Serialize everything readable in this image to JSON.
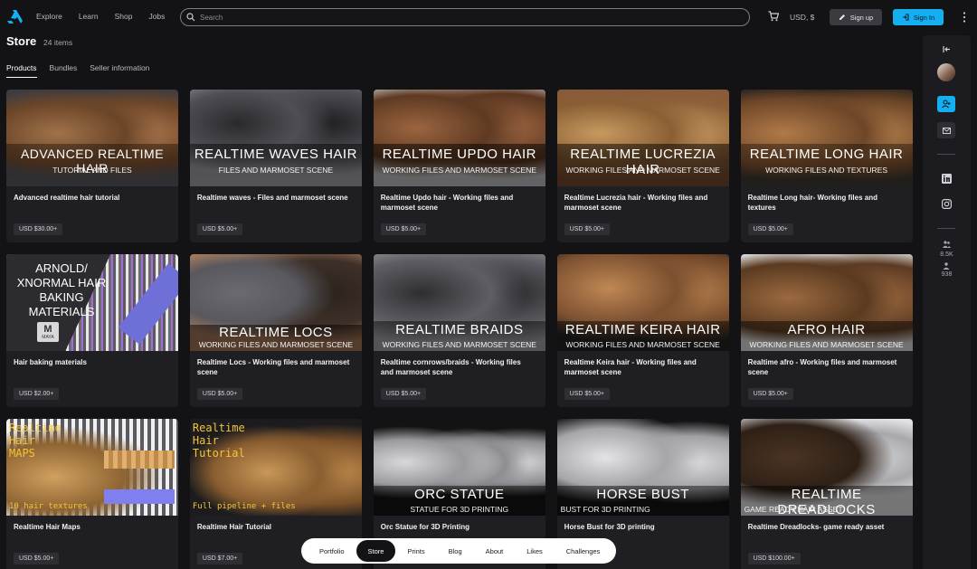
{
  "nav": {
    "links": [
      "Explore",
      "Learn",
      "Shop",
      "Jobs"
    ],
    "search_placeholder": "Search",
    "currency": "USD, $",
    "signup": "Sign up",
    "signin": "Sign In"
  },
  "header": {
    "title": "Store",
    "count": "24 items",
    "tabs": [
      "Products",
      "Bundles",
      "Seller information"
    ]
  },
  "products": [
    {
      "title": "Advanced realtime hair tutorial",
      "price": "USD $30.00+",
      "thumb_l1": "ADVANCED REALTIME HAIR",
      "thumb_l2": "TUTORIAL AND FILES"
    },
    {
      "title": "Realtime waves - Files and marmoset scene",
      "price": "USD $5.00+",
      "thumb_l1": "REALTIME WAVES HAIR",
      "thumb_l2": "FILES AND MARMOSET SCENE"
    },
    {
      "title": "Realtime Updo hair - Working files and marmoset scene",
      "price": "USD $5.00+",
      "thumb_l1": "REALTIME UPDO HAIR",
      "thumb_l2": "WORKING FILES AND MARMOSET SCENE"
    },
    {
      "title": "Realtime Lucrezia hair - Working files and marmoset scene",
      "price": "USD $5.00+",
      "thumb_l1": "REALTIME LUCREZIA HAIR",
      "thumb_l2": "WORKING FILES AND MARMOSET SCENE"
    },
    {
      "title": "Realtime Long hair- Working files and textures",
      "price": "USD $5.00+",
      "thumb_l1": "REALTIME LONG HAIR",
      "thumb_l2": "WORKING FILES AND TEXTURES"
    },
    {
      "title": "Hair baking materials",
      "price": "USD $2.00+",
      "thumb_l1": "ARNOLD/ XNORMAL HAIR BAKING MATERIALS",
      "thumb_l2": "MAYA"
    },
    {
      "title": "Realtime Locs - Working files and marmoset scene",
      "price": "USD $5.00+",
      "thumb_l1": "REALTIME LOCS",
      "thumb_l2": "WORKING FILES AND MARMOSET SCENE"
    },
    {
      "title": "Realtime cornrows/braids - Working files and marmoset scene",
      "price": "USD $5.00+",
      "thumb_l1": "REALTIME BRAIDS",
      "thumb_l2": "WORKING FILES AND MARMOSET SCENE"
    },
    {
      "title": "Realtime Keira hair - Working files and marmoset scene",
      "price": "USD $5.00+",
      "thumb_l1": "REALTIME KEIRA HAIR",
      "thumb_l2": "WORKING FILES AND MARMOSET SCENE"
    },
    {
      "title": "Realtime afro - Working files and marmoset scene",
      "price": "USD $5.00+",
      "thumb_l1": "AFRO HAIR",
      "thumb_l2": "WORKING FILES AND MARMOSET SCENE"
    },
    {
      "title": "Realtime Hair Maps",
      "price": "USD $5.00+",
      "thumb_l1": "Realtime Hair MAPS",
      "thumb_l2": "10 hair textures"
    },
    {
      "title": "Realtime Hair Tutorial",
      "price": "USD $7.00+",
      "thumb_l1": "Realtime Hair Tutorial",
      "thumb_l2": "Full pipeline + files"
    },
    {
      "title": "Orc Statue for 3D Printing",
      "price": "",
      "thumb_l1": "ORC STATUE",
      "thumb_l2": "STATUE FOR 3D PRINTING"
    },
    {
      "title": "Horse Bust for 3D printing",
      "price": "",
      "thumb_l1": "HORSE BUST",
      "thumb_l2": "BUST FOR 3D PRINTING"
    },
    {
      "title": "Realtime Dreadlocks- game ready asset",
      "price": "USD $100.00+",
      "thumb_l1": "REALTIME DREADLOCKS",
      "thumb_l2": "GAME READY HAIR ASSET"
    }
  ],
  "rail": {
    "followers": "8.5K",
    "following": "938"
  },
  "bottom_nav": [
    "Portfolio",
    "Store",
    "Prints",
    "Blog",
    "About",
    "Likes",
    "Challenges"
  ],
  "colors": {
    "background": "#131316",
    "card": "#1f1f23",
    "accent": "#13aff0"
  }
}
